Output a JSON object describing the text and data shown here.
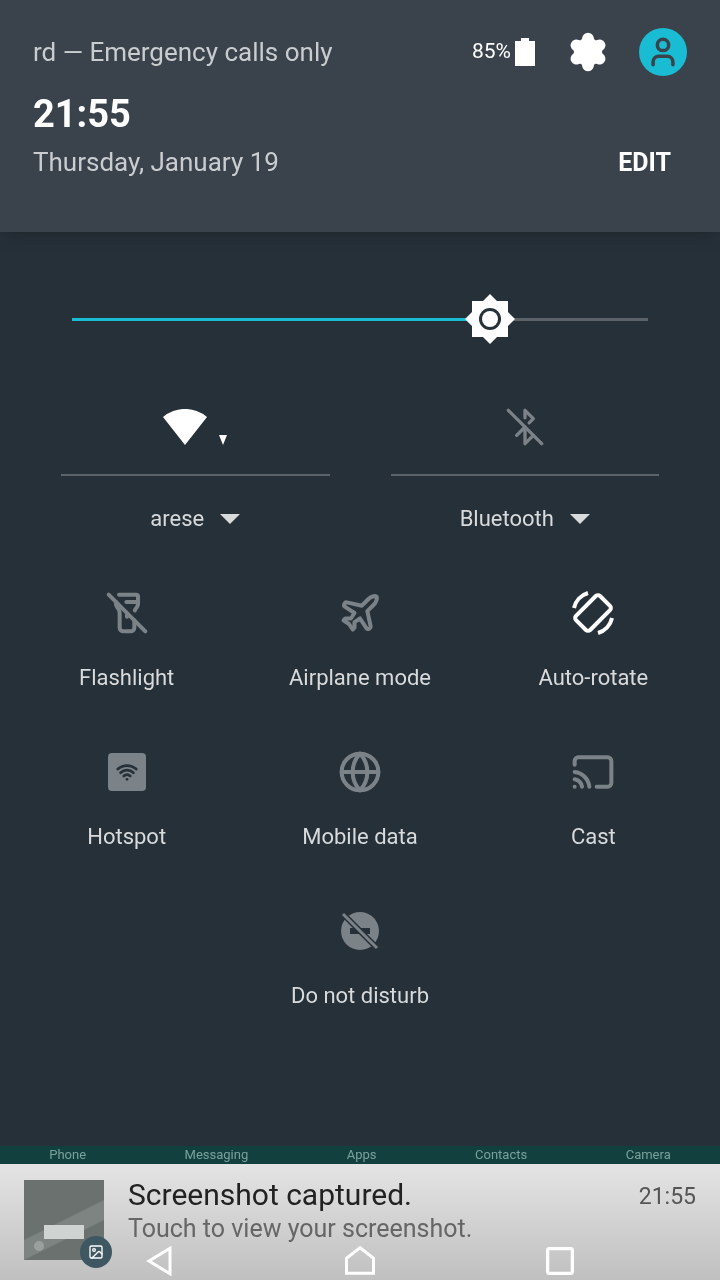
{
  "header": {
    "carrier": "rd — Emergency calls only",
    "battery": "85%",
    "time": "21:55",
    "date": "Thursday, January 19",
    "edit": "EDIT"
  },
  "brightness": {
    "level": 0.726
  },
  "big_tiles": [
    {
      "kind": "wifi",
      "label": "arese",
      "on": true
    },
    {
      "kind": "bluetooth",
      "label": "Bluetooth",
      "on": false
    }
  ],
  "tiles": [
    {
      "kind": "flashlight",
      "label": "Flashlight",
      "on": false
    },
    {
      "kind": "airplane",
      "label": "Airplane mode",
      "on": false
    },
    {
      "kind": "rotate",
      "label": "Auto-rotate",
      "on": true
    },
    {
      "kind": "hotspot",
      "label": "Hotspot",
      "on": false
    },
    {
      "kind": "globe",
      "label": "Mobile data",
      "on": false
    },
    {
      "kind": "cast",
      "label": "Cast",
      "on": false
    },
    {
      "kind": "dnd",
      "label": "Do not disturb",
      "on": false
    }
  ],
  "dock": [
    "Phone",
    "Messaging",
    "Apps",
    "Contacts",
    "Camera"
  ],
  "notification": {
    "title": "Screenshot captured.",
    "text": "Touch to view your screenshot.",
    "time": "21:55"
  }
}
